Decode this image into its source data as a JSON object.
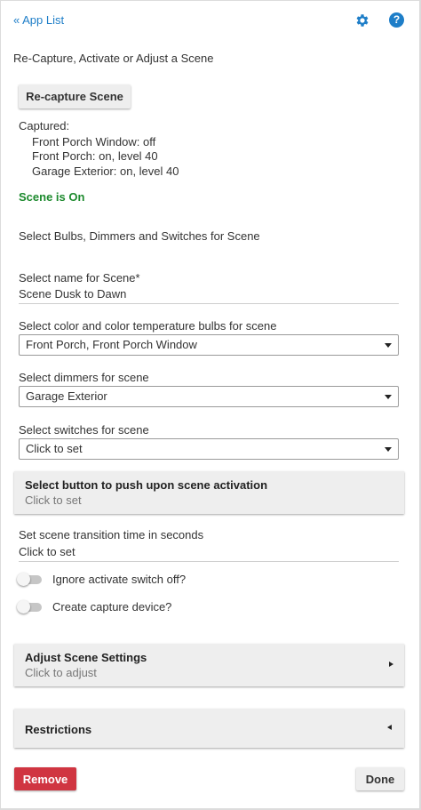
{
  "header": {
    "back_label": "« App List",
    "help_glyph": "?",
    "accent_color": "#1e7ec8"
  },
  "title": "Re-Capture, Activate or Adjust a Scene",
  "recapture_button": "Re-capture Scene",
  "captured": {
    "heading": "Captured:",
    "lines": [
      "Front Porch Window: off",
      "Front Porch: on, level 40",
      "Garage Exterior: on, level 40"
    ]
  },
  "scene_status": "Scene is On",
  "section_note": "Select Bulbs, Dimmers and Switches for Scene",
  "fields": {
    "scene_name": {
      "label": "Select name for Scene*",
      "value": "Scene Dusk to Dawn"
    },
    "color_bulbs": {
      "label": "Select color and color temperature bulbs for scene",
      "value": "Front Porch, Front Porch Window"
    },
    "dimmers": {
      "label": "Select dimmers for scene",
      "value": "Garage Exterior"
    },
    "switches": {
      "label": "Select switches for scene",
      "value": "Click to set"
    },
    "transition": {
      "label": "Set scene transition time in seconds",
      "value": "Click to set"
    }
  },
  "panels": {
    "button_push": {
      "title": "Select button to push upon scene activation",
      "subtitle": "Click to set"
    },
    "adjust": {
      "title": "Adjust Scene Settings",
      "subtitle": "Click to adjust"
    },
    "restrictions": {
      "title": "Restrictions"
    }
  },
  "toggles": {
    "ignore_switch_off": {
      "label": "Ignore activate switch off?",
      "on": false
    },
    "create_capture": {
      "label": "Create capture device?",
      "on": false
    }
  },
  "footer": {
    "remove_label": "Remove",
    "done_label": "Done",
    "remove_color": "#d03541"
  }
}
